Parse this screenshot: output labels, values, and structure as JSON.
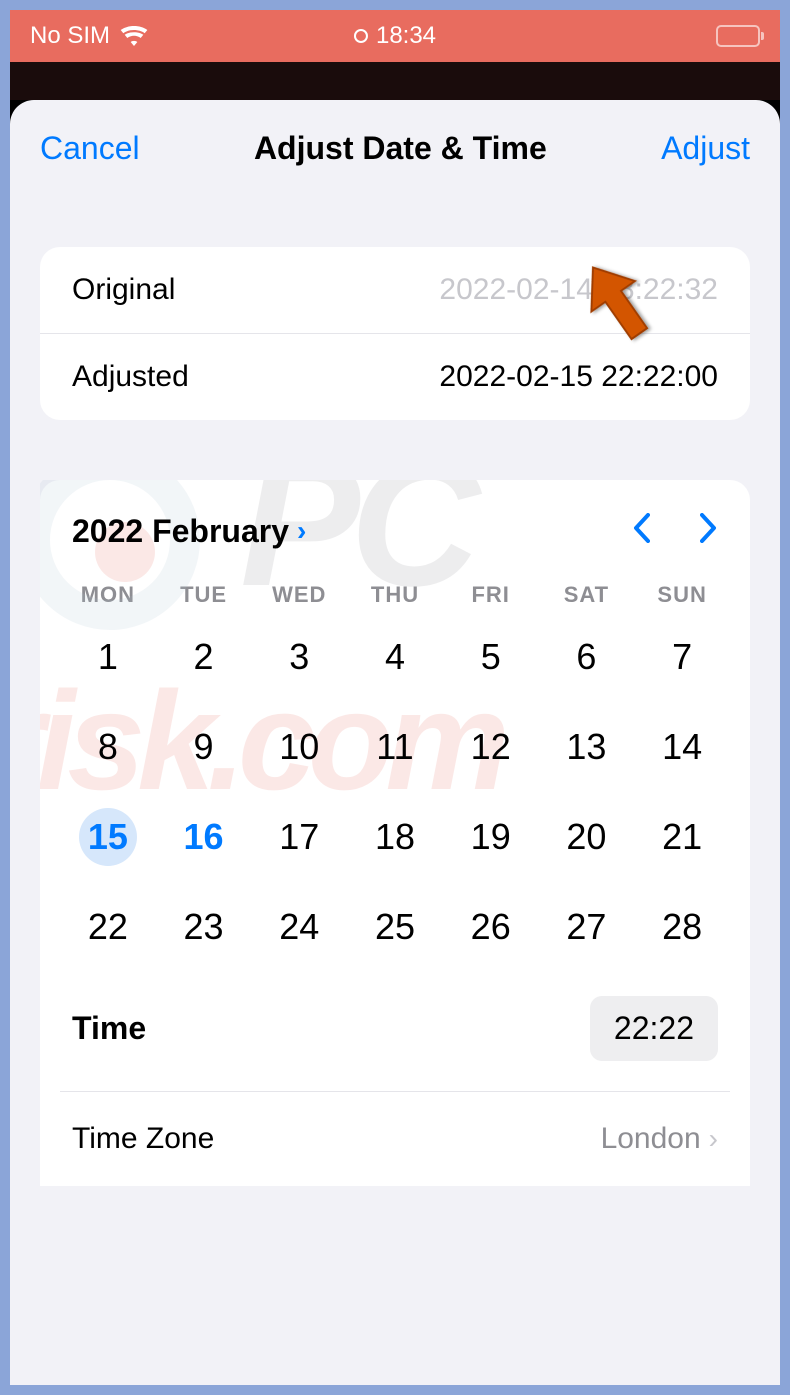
{
  "status_bar": {
    "sim_text": "No SIM",
    "time": "18:34"
  },
  "modal": {
    "cancel_label": "Cancel",
    "title": "Adjust Date & Time",
    "adjust_label": "Adjust"
  },
  "info": {
    "original_label": "Original",
    "original_value": "2022-02-14 18:22:32",
    "adjusted_label": "Adjusted",
    "adjusted_value": "2022-02-15 22:22:00"
  },
  "calendar": {
    "month_year": "2022 February",
    "weekdays": [
      "MON",
      "TUE",
      "WED",
      "THU",
      "FRI",
      "SAT",
      "SUN"
    ],
    "leading_blanks": 0,
    "days_in_month": 28,
    "selected_day": 15,
    "today_day": 16
  },
  "time": {
    "label": "Time",
    "value": "22:22"
  },
  "timezone": {
    "label": "Time Zone",
    "value": "London"
  }
}
